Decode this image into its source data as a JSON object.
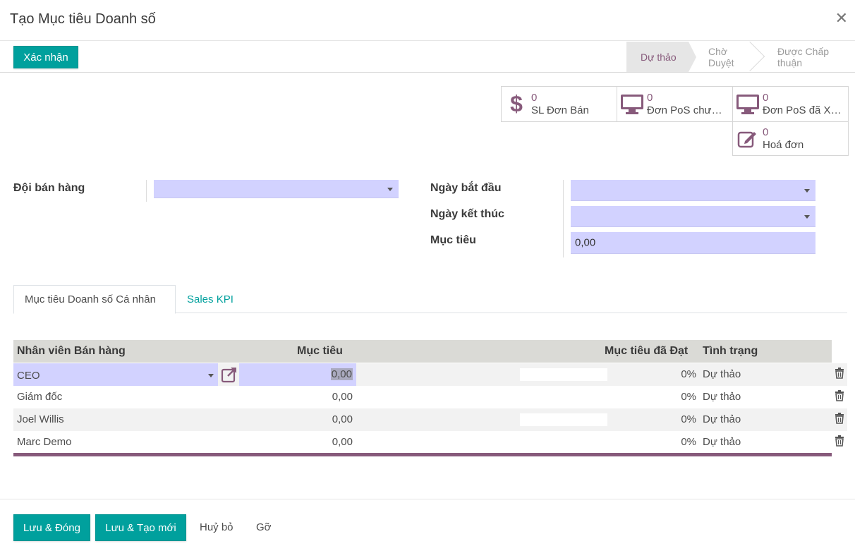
{
  "dialog": {
    "title": "Tạo Mục tiêu Doanh số"
  },
  "statusbar": {
    "confirm_label": "Xác nhận",
    "stages": [
      "Dự thảo",
      "Chờ Duyệt",
      "Được Chấp thuận"
    ],
    "active_stage": "Dự thảo"
  },
  "smart_buttons": [
    {
      "count": "0",
      "label": "SL Đơn Bán",
      "icon": "dollar-icon"
    },
    {
      "count": "0",
      "label": "Đơn PoS chưa xử lý",
      "icon": "monitor-icon"
    },
    {
      "count": "0",
      "label": "Đơn PoS đã Xử lý",
      "icon": "monitor-icon"
    },
    {
      "count": "0",
      "label": "Hoá đơn",
      "icon": "edit-icon"
    }
  ],
  "form": {
    "team_label": "Đội bán hàng",
    "team_value": "",
    "start_label": "Ngày bắt đầu",
    "start_value": "",
    "end_label": "Ngày kết thúc",
    "end_value": "",
    "target_label": "Mục tiêu",
    "target_value": "0,00"
  },
  "tabs": [
    "Mục tiêu Doanh số Cá nhân",
    "Sales KPI"
  ],
  "table": {
    "columns": {
      "salesperson": "Nhân viên Bán hàng",
      "target": "Mục tiêu",
      "achieved": "Mục tiêu đã Đạt",
      "status": "Tình trạng"
    },
    "rows": [
      {
        "name": "CEO",
        "target": "0,00",
        "achieved": "0%",
        "status": "Dự thảo"
      },
      {
        "name": "Giám đốc",
        "target": "0,00",
        "achieved": "0%",
        "status": "Dự thảo"
      },
      {
        "name": "Joel Willis",
        "target": "0,00",
        "achieved": "0%",
        "status": "Dự thảo"
      },
      {
        "name": "Marc Demo",
        "target": "0,00",
        "achieved": "0%",
        "status": "Dự thảo"
      }
    ]
  },
  "footer": {
    "save_close": "Lưu & Đóng",
    "save_new": "Lưu & Tạo mới",
    "cancel": "Huỷ bỏ",
    "discard": "Gỡ"
  },
  "colors": {
    "primary": "#00a09d",
    "brand": "#875a7b",
    "input_bg": "#d2d2ff"
  }
}
